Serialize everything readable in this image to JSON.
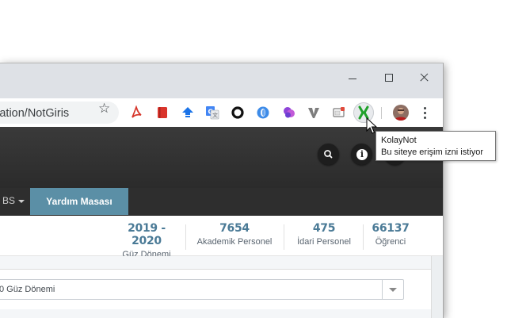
{
  "browser": {
    "url": "aluation/NotGiris",
    "tooltip": {
      "title": "KolayNot",
      "text": "Bu siteye erişim izni istiyor"
    },
    "extensions": [
      "pdf-icon",
      "red-book-icon",
      "blue-upload-icon",
      "translate-icon",
      "ring-icon",
      "opera-icon",
      "purple-flower-icon",
      "vee-icon",
      "card-icon",
      "kolaynot-icon"
    ]
  },
  "nav": {
    "bs_label": "BS",
    "help_label": "Yardım Masası"
  },
  "stats": [
    {
      "value": "2019 - 2020",
      "label": "Güz Dönemi"
    },
    {
      "value": "7654",
      "label": "Akademik Personel"
    },
    {
      "value": "475",
      "label": "İdari Personel"
    },
    {
      "value": "66137",
      "label": "Öğrenci"
    }
  ],
  "term_select": {
    "value": "0 Güz Dönemi"
  },
  "colors": {
    "accent": "#5b8fa6",
    "stat_number": "#4a7a96",
    "header_dark": "#2e2e2e"
  }
}
